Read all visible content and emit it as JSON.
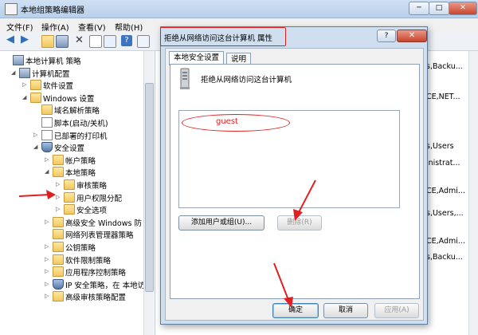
{
  "window": {
    "title": "本地组策略编辑器",
    "controls": {
      "minimize": "─",
      "maximize": "□",
      "close": "✕"
    }
  },
  "menu": [
    "文件(F)",
    "操作(A)",
    "查看(V)",
    "帮助(H)"
  ],
  "tree": [
    {
      "label": "本地计算机 策略",
      "icon": "computer-icon",
      "twisty": ""
    },
    {
      "label": "计算机配置",
      "icon": "computer-icon",
      "twisty": "◢"
    },
    {
      "label": "软件设置",
      "icon": "folder-icon",
      "twisty": "▷"
    },
    {
      "label": "Windows 设置",
      "icon": "folder-icon",
      "twisty": "◢"
    },
    {
      "label": "域名解析策略",
      "icon": "folder-icon",
      "twisty": ""
    },
    {
      "label": "脚本(启动/关机)",
      "icon": "script-icon",
      "twisty": ""
    },
    {
      "label": "已部署的打印机",
      "icon": "printer-icon",
      "twisty": "▷"
    },
    {
      "label": "安全设置",
      "icon": "security-icon",
      "twisty": "◢"
    },
    {
      "label": "帐户策略",
      "icon": "folder-icon",
      "twisty": "▷"
    },
    {
      "label": "本地策略",
      "icon": "folder-icon",
      "twisty": "◢"
    },
    {
      "label": "审核策略",
      "icon": "folder-icon",
      "twisty": "▷"
    },
    {
      "label": "用户权限分配",
      "icon": "folder-icon",
      "twisty": "▷"
    },
    {
      "label": "安全选项",
      "icon": "folder-icon",
      "twisty": "▷"
    },
    {
      "label": "高级安全 Windows 防",
      "icon": "folder-icon",
      "twisty": "▷"
    },
    {
      "label": "网络列表管理器策略",
      "icon": "folder-icon",
      "twisty": ""
    },
    {
      "label": "公钥策略",
      "icon": "folder-icon",
      "twisty": "▷"
    },
    {
      "label": "软件限制策略",
      "icon": "folder-icon",
      "twisty": "▷"
    },
    {
      "label": "应用程序控制策略",
      "icon": "folder-icon",
      "twisty": "▷"
    },
    {
      "label": "IP 安全策略，在 本地访",
      "icon": "ip-security-icon",
      "twisty": "▷"
    },
    {
      "label": "高级审核策略配置",
      "icon": "folder-icon",
      "twisty": "▷"
    }
  ],
  "right_pane_values": [
    "s,Backu...",
    "CE,NET...",
    "s,Users",
    "inistrat...",
    "CE,Admi...",
    "s,Users,...",
    "CE,Admi...",
    "s,Backu..."
  ],
  "dialog": {
    "title": "拒绝从网络访问这台计算机 属性",
    "help": "?",
    "close": "✕",
    "tabs": [
      "本地安全设置",
      "说明"
    ],
    "policy_name": "拒绝从网络访问这台计算机",
    "users": [
      "guest"
    ],
    "add_button": "添加用户或组(U)...",
    "remove_button": "删除(R)",
    "ok_button": "确定",
    "cancel_button": "取消",
    "apply_button": "应用(A)"
  },
  "colors": {
    "annotation_red": "#e02020",
    "titlebar": "#b9d0ea"
  }
}
